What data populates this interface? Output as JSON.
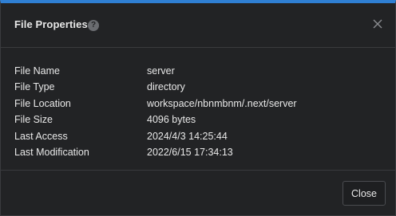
{
  "dialog": {
    "title": "File Properties",
    "help_icon": "?",
    "close_icon": "close-icon",
    "accent_color": "#2f7fd3"
  },
  "properties": [
    {
      "label": "File Name",
      "value": "server"
    },
    {
      "label": "File Type",
      "value": "directory"
    },
    {
      "label": "File Location",
      "value": "workspace/nbnmbnm/.next/server"
    },
    {
      "label": "File Size",
      "value": "4096 bytes"
    },
    {
      "label": "Last Access",
      "value": "2024/4/3 14:25:44"
    },
    {
      "label": "Last Modification",
      "value": "2022/6/15 17:34:13"
    }
  ],
  "footer": {
    "close_label": "Close"
  }
}
